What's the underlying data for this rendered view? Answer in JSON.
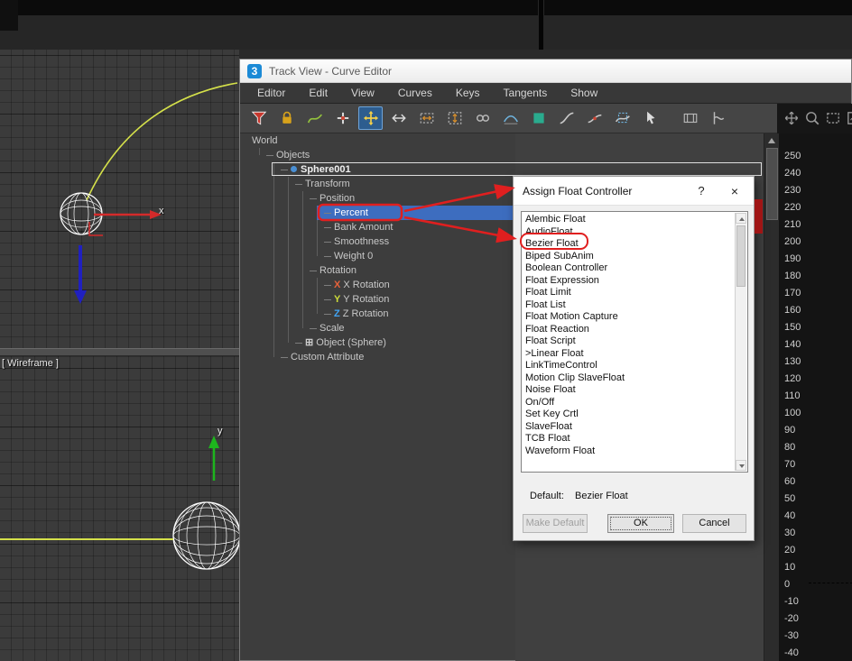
{
  "window": {
    "logo_text": "3",
    "title": "Track View - Curve Editor"
  },
  "menu": {
    "items": [
      "Editor",
      "Edit",
      "View",
      "Curves",
      "Keys",
      "Tangents",
      "Show"
    ]
  },
  "toolbar": {
    "main_icons": [
      {
        "name": "filter-icon"
      },
      {
        "name": "lock-keys-icon"
      },
      {
        "name": "draw-curves-icon"
      },
      {
        "name": "add-keys-icon"
      },
      {
        "name": "move-keys-icon",
        "active": true
      },
      {
        "name": "slide-keys-icon"
      },
      {
        "name": "scale-keys-icon"
      },
      {
        "name": "scale-values-icon"
      },
      {
        "name": "retime-icon"
      },
      {
        "name": "parameter-out-of-range-icon"
      },
      {
        "name": "isolate-curve-icon"
      },
      {
        "name": "ease-curve-icon"
      },
      {
        "name": "multiplier-curve-icon"
      },
      {
        "name": "region-tool-icon"
      },
      {
        "name": "select-tool-icon"
      }
    ],
    "secondary_icons": [
      {
        "name": "retimer-icon"
      },
      {
        "name": "snap-frames-icon"
      }
    ],
    "dark_icons": [
      {
        "name": "pan-icon"
      },
      {
        "name": "zoom-icon"
      },
      {
        "name": "zoom-region-icon"
      },
      {
        "name": "frame-all-icon"
      }
    ]
  },
  "viewport": {
    "wireframe_label": "[ Wireframe ]",
    "axis_x_label": "x",
    "axis_y_label": "y"
  },
  "tree": {
    "items": [
      {
        "label": "World",
        "level": 0
      },
      {
        "label": "Objects",
        "level": 1
      },
      {
        "label": "Sphere001",
        "level": 2,
        "bold": true,
        "boxed": true,
        "icon": "blue-dot"
      },
      {
        "label": "Transform",
        "level": 3
      },
      {
        "label": "Position",
        "level": 4
      },
      {
        "label": "Percent",
        "level": 5,
        "selected": true
      },
      {
        "label": "Bank Amount",
        "level": 5
      },
      {
        "label": "Smoothness",
        "level": 5
      },
      {
        "label": "Weight 0",
        "level": 5
      },
      {
        "label": "Rotation",
        "level": 4
      },
      {
        "label": "X Rotation",
        "level": 5,
        "prefix": "X",
        "prefix_color": "#e8623a"
      },
      {
        "label": "Y Rotation",
        "level": 5,
        "prefix": "Y",
        "prefix_color": "#cddc39"
      },
      {
        "label": "Z Rotation",
        "level": 5,
        "prefix": "Z",
        "prefix_color": "#42a5f5"
      },
      {
        "label": "Scale",
        "level": 4
      },
      {
        "label": "Object (Sphere)",
        "level": 3,
        "prefix": "⊞",
        "prefix_color": "#cccccc"
      },
      {
        "label": "Custom Attribute",
        "level": 2
      }
    ]
  },
  "dialog": {
    "title": "Assign Float Controller",
    "help_button": "?",
    "close_button": "×",
    "list_items": [
      "Alembic Float",
      "AudioFloat",
      "Bezier Float",
      "Biped SubAnim",
      "Boolean Controller",
      "Float Expression",
      "Float Limit",
      "Float List",
      "Float Motion Capture",
      "Float Reaction",
      "Float Script",
      ">Linear Float",
      "LinkTimeControl",
      "Motion Clip SlaveFloat",
      "Noise Float",
      "On/Off",
      "Set Key Crtl",
      "SlaveFloat",
      "TCB Float",
      "Waveform Float"
    ],
    "annotated_item": "Bezier Float",
    "default_label": "Default:",
    "default_value": "Bezier Float",
    "buttons": {
      "make_default": "Make Default",
      "ok": "OK",
      "cancel": "Cancel"
    }
  },
  "ruler": {
    "values": [
      250,
      240,
      230,
      220,
      210,
      200,
      190,
      180,
      170,
      160,
      150,
      140,
      130,
      120,
      110,
      100,
      90,
      80,
      70,
      60,
      50,
      40,
      30,
      20,
      10,
      0,
      -10,
      -20,
      -30,
      -40
    ]
  },
  "colors": {
    "annotation_red": "#e01f1f",
    "selection_blue": "#3d6dbf",
    "active_button_blue": "#2d5d8f",
    "trajectory_yellow": "#d4e04a",
    "axis_x_red": "#d42a2a",
    "axis_y_green": "#1db51d",
    "axis_z_blue": "#2020c0"
  }
}
